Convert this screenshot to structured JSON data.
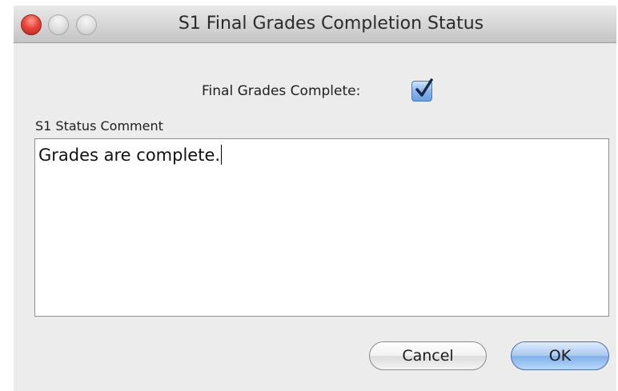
{
  "window": {
    "title": "S1 Final Grades Completion Status"
  },
  "form": {
    "complete_label": "Final Grades Complete:",
    "complete_checked": true,
    "comment_label": "S1 Status Comment",
    "comment_value": "Grades are complete."
  },
  "buttons": {
    "cancel_label": "Cancel",
    "ok_label": "OK"
  },
  "colors": {
    "close_button": "#e8443a",
    "default_button": "#7fb0ec",
    "checkbox": "#6a9fe0"
  }
}
